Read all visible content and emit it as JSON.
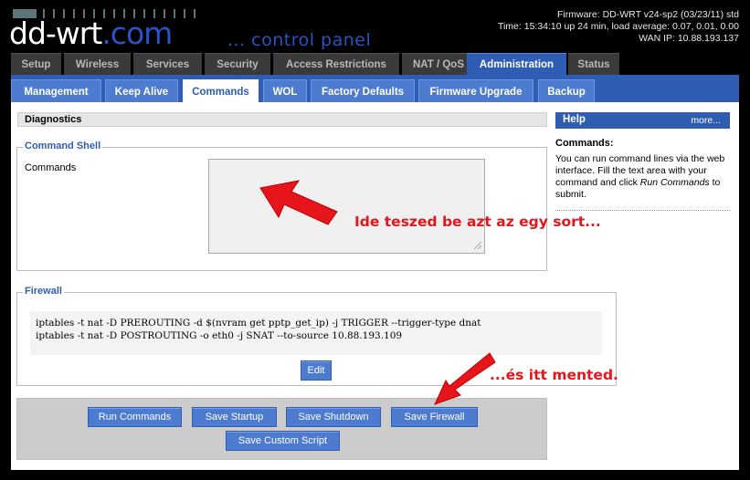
{
  "header": {
    "logo_main": "dd-wrt",
    "logo_dotcom": ".com",
    "logo_sub": "... control panel",
    "firmware": "Firmware: DD-WRT v24-sp2 (03/23/11) std",
    "time": "Time: 15:34:10 up 24 min, load average: 0.07, 0.01, 0.00",
    "wan_ip": "WAN IP: 10.88.193.137"
  },
  "main_tabs": [
    "Setup",
    "Wireless",
    "Services",
    "Security",
    "Access Restrictions",
    "NAT / QoS",
    "Administration",
    "Status"
  ],
  "main_tab_active": "Administration",
  "sub_tabs": [
    "Management",
    "Keep Alive",
    "Commands",
    "WOL",
    "Factory Defaults",
    "Firmware Upgrade",
    "Backup"
  ],
  "sub_tab_active": "Commands",
  "diagnostics": {
    "title": "Diagnostics",
    "command_shell_legend": "Command Shell",
    "commands_label": "Commands",
    "commands_value": ""
  },
  "firewall": {
    "legend": "Firewall",
    "lines": [
      "iptables -t nat -D PREROUTING -d $(nvram get pptp_get_ip) -j TRIGGER --trigger-type dnat",
      "iptables -t nat -D POSTROUTING -o eth0 -j SNAT --to-source 10.88.193.109"
    ],
    "edit_label": "Edit"
  },
  "buttons": {
    "run_commands": "Run Commands",
    "save_startup": "Save Startup",
    "save_shutdown": "Save Shutdown",
    "save_firewall": "Save Firewall",
    "save_custom_script": "Save Custom Script"
  },
  "help": {
    "title": "Help",
    "more": "more...",
    "subtitle": "Commands:",
    "body_prefix": "You can run command lines via the web interface. Fill the text area with your command and click ",
    "body_em": "Run Commands",
    "body_suffix": " to submit."
  },
  "annotations": {
    "arrow1_text": "Ide teszed be azt az egy sort...",
    "arrow2_text": "...és itt mented."
  },
  "colors": {
    "accent_blue": "#2f5db3",
    "tab_blue": "#4d7bd0",
    "annotation_red": "#e8141b"
  }
}
